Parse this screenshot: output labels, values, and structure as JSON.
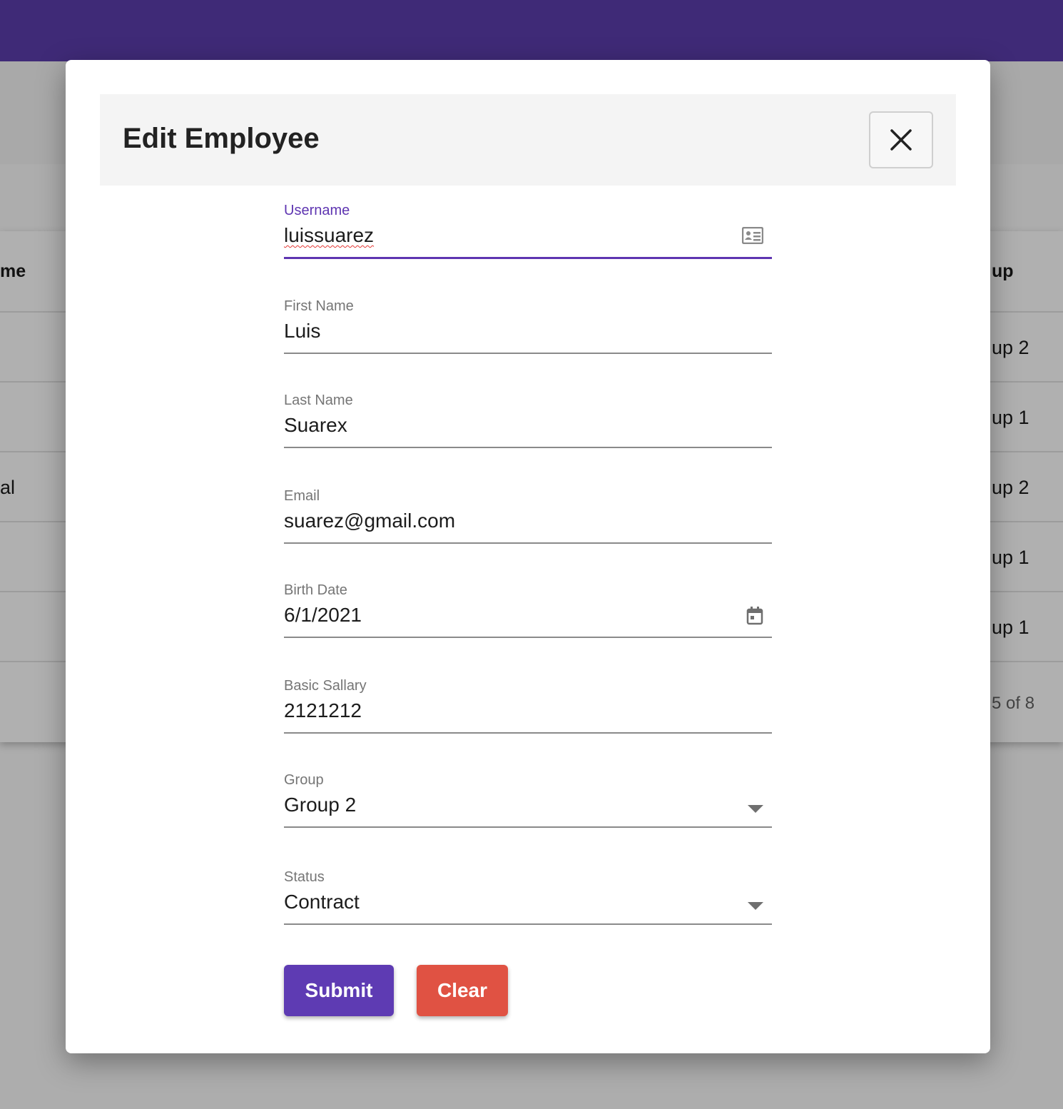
{
  "background": {
    "table_header_left": "me",
    "table_header_right": "up",
    "left_cells": [
      "",
      "",
      "al",
      "",
      ""
    ],
    "right_cells": [
      "up 2",
      "up 1",
      "up 2",
      "up 1",
      "up 1"
    ],
    "pagination": "5 of 8"
  },
  "dialog": {
    "title": "Edit Employee",
    "close_icon": "close-icon",
    "fields": {
      "username": {
        "label": "Username",
        "value": "luissuarez",
        "icon": "contact-card-icon"
      },
      "first_name": {
        "label": "First Name",
        "value": "Luis"
      },
      "last_name": {
        "label": "Last Name",
        "value": "Suarex"
      },
      "email": {
        "label": "Email",
        "value": "suarez@gmail.com"
      },
      "birth_date": {
        "label": "Birth Date",
        "value": "6/1/2021",
        "icon": "calendar-icon"
      },
      "basic_salary": {
        "label": "Basic Sallary",
        "value": "2121212"
      },
      "group": {
        "label": "Group",
        "value": "Group 2",
        "icon": "dropdown-arrow-icon"
      },
      "status": {
        "label": "Status",
        "value": "Contract",
        "icon": "dropdown-arrow-icon"
      }
    },
    "buttons": {
      "submit": "Submit",
      "clear": "Clear"
    }
  },
  "colors": {
    "topbar": "#3f2a77",
    "accent": "#5e35b1",
    "submit": "#5e3bb3",
    "clear": "#e05243"
  }
}
